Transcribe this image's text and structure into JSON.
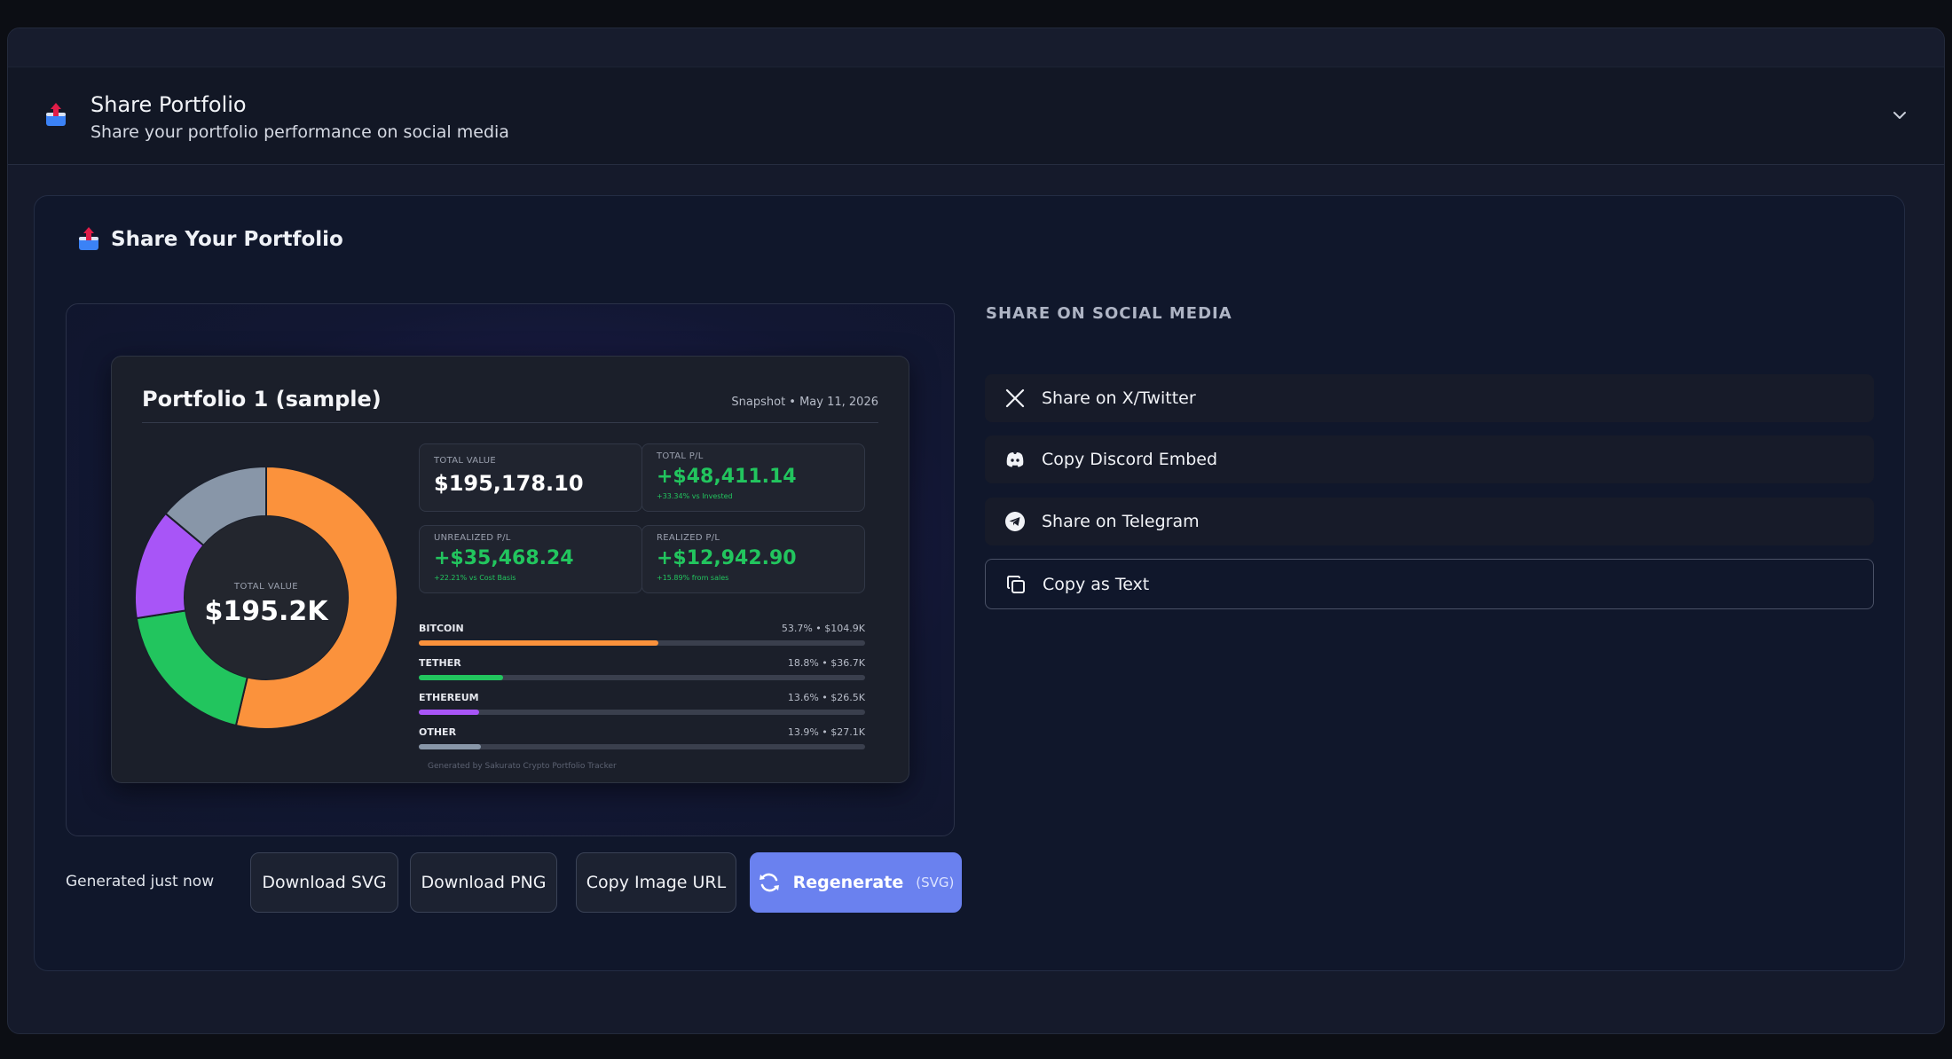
{
  "header": {
    "title": "Share Portfolio",
    "subtitle": "Share your portfolio performance on social media"
  },
  "card": {
    "title": "Share Your Portfolio"
  },
  "snapshot": {
    "portfolio_name": "Portfolio 1 (sample)",
    "date": "Snapshot • May 11, 2026",
    "donut_label": "TOTAL VALUE",
    "donut_value": "$195.2K",
    "stats": [
      {
        "label": "TOTAL VALUE",
        "value": "$195,178.10",
        "sub": ""
      },
      {
        "label": "TOTAL P/L",
        "value": "+$48,411.14",
        "sub": "+33.34% vs Invested"
      },
      {
        "label": "UNREALIZED P/L",
        "value": "+$35,468.24",
        "sub": "+22.21% vs Cost Basis"
      },
      {
        "label": "REALIZED P/L",
        "value": "+$12,942.90",
        "sub": "+15.89% from sales"
      }
    ],
    "allocation": [
      {
        "name": "BITCOIN",
        "pct_text": "53.7% • $104.9K",
        "pct": 53.7,
        "color": "#fb923c"
      },
      {
        "name": "TETHER",
        "pct_text": "18.8% • $36.7K",
        "pct": 18.8,
        "color": "#22c55e"
      },
      {
        "name": "ETHEREUM",
        "pct_text": "13.6% • $26.5K",
        "pct": 13.6,
        "color": "#a855f7"
      },
      {
        "name": "OTHER",
        "pct_text": "13.9% • $27.1K",
        "pct": 13.9,
        "color": "#8896a8"
      }
    ],
    "footer": "Generated by Sakurato Crypto Portfolio Tracker"
  },
  "actions": {
    "generated": "Generated just now",
    "download_svg": "Download SVG",
    "download_png": "Download PNG",
    "copy_url": "Copy Image URL",
    "regenerate": "Regenerate",
    "regenerate_tag": "(SVG)"
  },
  "social": {
    "title": "SHARE ON SOCIAL MEDIA",
    "items": [
      {
        "label": "Share on X/Twitter",
        "icon": "x-twitter-icon"
      },
      {
        "label": "Copy Discord Embed",
        "icon": "discord-icon"
      },
      {
        "label": "Share on Telegram",
        "icon": "telegram-icon"
      },
      {
        "label": "Copy as Text",
        "icon": "copy-icon"
      }
    ]
  },
  "colors": {
    "accent": "#6a81ef",
    "positive": "#22c55e"
  }
}
